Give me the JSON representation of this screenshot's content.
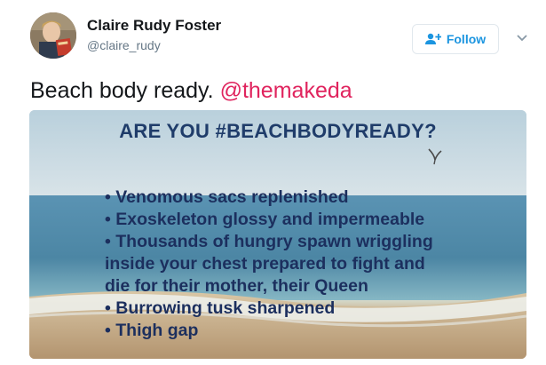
{
  "author": {
    "name": "Claire Rudy Foster",
    "handle": "@claire_rudy",
    "avatar_icon": "user-avatar"
  },
  "actions": {
    "follow_label": "Follow",
    "follow_icon": "add-user-icon",
    "menu_icon": "chevron-down-icon"
  },
  "tweet": {
    "text": "Beach body ready.",
    "mention": "@themakeda"
  },
  "media": {
    "title": "ARE YOU #BEACHBODYREADY?",
    "bullets": [
      "• Venomous sacs replenished",
      "• Exoskeleton glossy and impermeable",
      "• Thousands of hungry spawn wriggling",
      "inside your chest prepared to fight and",
      "die for their mother, their Queen",
      "• Burrowing tusk sharpened",
      "• Thigh gap"
    ]
  },
  "colors": {
    "follow_blue": "#1b95e0",
    "mention_red": "#e0245e",
    "poster_text": "#1c2f5e"
  }
}
